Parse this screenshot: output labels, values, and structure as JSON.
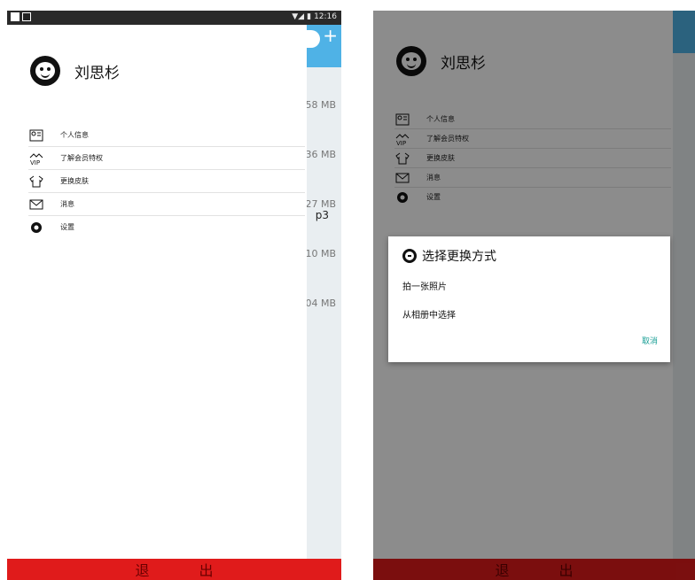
{
  "status_bar": {
    "time": "12:16",
    "signal": "▼◢",
    "battery": "▮"
  },
  "user": {
    "name": "刘思杉"
  },
  "menu": [
    {
      "label": "个人信息",
      "icon": "id-card-icon"
    },
    {
      "label": "了解会员特权",
      "icon": "vip-crown-icon"
    },
    {
      "label": "更换皮肤",
      "icon": "tshirt-icon"
    },
    {
      "label": "消息",
      "icon": "envelope-icon"
    },
    {
      "label": "设置",
      "icon": "gear-icon"
    }
  ],
  "background_list": [
    {
      "size": "58 MB"
    },
    {
      "size": "36 MB"
    },
    {
      "size": "27 MB"
    },
    {
      "size": "10 MB"
    },
    {
      "size": "04 MB"
    }
  ],
  "bg_fragment": "p3",
  "logout": {
    "char1": "退",
    "char2": "出"
  },
  "dialog": {
    "title": "选择更换方式",
    "option1": "拍一张照片",
    "option2": "从相册中选择",
    "cancel": "取消"
  },
  "colors": {
    "accent": "#4fb2e6",
    "logout": "#e01b1b",
    "cancel": "#1a9f96"
  }
}
